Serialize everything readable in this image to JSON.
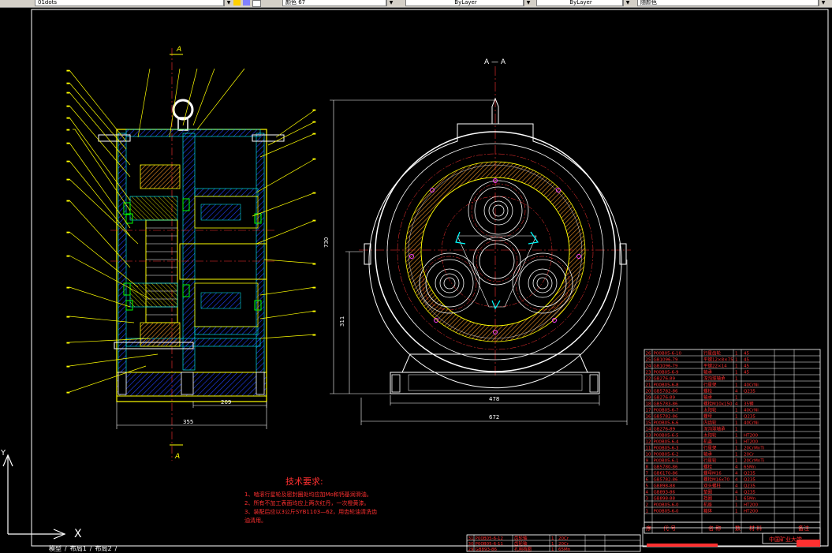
{
  "toolbar": {
    "layer_field": "01dots",
    "color_field": "颜色 67",
    "linetype_field": "ByLayer",
    "lineweight_field": "ByLayer",
    "plotstyle_field": "随颜色"
  },
  "drawing": {
    "section_mark": "A",
    "view_title": "A — A",
    "dims": {
      "width_left": "355",
      "width_inner": "209",
      "height_total": "730",
      "height_center": "311",
      "width_base": "478",
      "width_total": "672"
    },
    "tech_req": {
      "title": "技术要求:",
      "lines": [
        "1、啮滚行星轮及密封圈处均应加Mo和钙基润滑油。",
        "2、所有不加工表面均应上两次红丹，一次橙黄漆。",
        "3、装配后应以3公斤SYB1103—62，用齿轮油清洗齿",
        "   油清用。"
      ]
    },
    "bom": {
      "rows": [
        [
          "P00B05-6-10",
          "行星齿轮",
          "1",
          "45"
        ],
        [
          "GB1096-79",
          "平键12×8×75",
          "1",
          "45"
        ],
        [
          "GB1096-79",
          "平键22×14",
          "1",
          "45"
        ],
        [
          "P00B05-6-9",
          "轴承",
          "1",
          "45"
        ],
        [
          "GB276-89",
          "深沟球轴承",
          "1",
          ""
        ],
        [
          "P00B05-6-8",
          "行星架",
          "1",
          "40CrNi"
        ],
        [
          "GB5782-86",
          "螺栓",
          "4",
          "Q235"
        ],
        [
          "GB276-89",
          "轴承",
          "1",
          ""
        ],
        [
          "GB5783-86",
          "螺栓M10x150",
          "4",
          "35钢"
        ],
        [
          "P00B05-6-7",
          "太阳轮",
          "1",
          "40CrNi"
        ],
        [
          "GB5782-86",
          "螺母",
          "1",
          "Q235"
        ],
        [
          "P00B05-6-6",
          "内齿轮",
          "1",
          "40CrNi"
        ],
        [
          "GB276-89",
          "深沟球轴承",
          "1",
          ""
        ],
        [
          "P00B05-6-5",
          "太阳轮",
          "1",
          "HT200"
        ],
        [
          "P00B05-6-4",
          "机盖",
          "1",
          "HT200"
        ],
        [
          "P00B05-6-3",
          "行星架",
          "1",
          "20CrMnTi"
        ],
        [
          "P00B05-6-2",
          "轴承",
          "1",
          "20Cr"
        ],
        [
          "P00B05-6-1",
          "行星轮",
          "1",
          "20CrMnTi"
        ],
        [
          "GB5780-86",
          "螺栓",
          "4",
          "65Mn"
        ],
        [
          "GB6170-86",
          "螺母M16",
          "4",
          "Q235"
        ],
        [
          "GB5782-86",
          "螺栓M16x70",
          "4",
          "Q235"
        ],
        [
          "GB898-88",
          "双头螺柱",
          "4",
          "Q235"
        ],
        [
          "GB893-86",
          "垫圈",
          "4",
          "Q235"
        ],
        [
          "GB898-88",
          "挡圈",
          "1",
          "65Mn"
        ],
        [
          "P00B05-6-0",
          "机座",
          "1",
          "HT200"
        ],
        [
          "P00B05-6-0",
          "箱体",
          "1",
          "HT200"
        ]
      ],
      "header": {
        "seq": "序",
        "code": "代  号",
        "name": "名  称",
        "qty": "数",
        "mat": "材  料",
        "note": "备注"
      },
      "school": "中国矿业大学"
    },
    "bom2": {
      "rows": [
        [
          "P00B05-6-12",
          "齿轮轴",
          "1",
          "20Cr"
        ],
        [
          "P00B05-6-11",
          "齿轮轴",
          "1",
          "20Cr"
        ],
        [
          "GB893-86",
          "孔用挡圈",
          "1",
          "65Mn"
        ]
      ]
    },
    "ucs": {
      "x": "X",
      "y": "Y"
    }
  },
  "tabs": {
    "model": "模型",
    "layout1": "布局1",
    "layout2": "布局2"
  },
  "colors": {
    "background": "#000000",
    "frame": "#ffffff",
    "outline": "#ffff00",
    "centerline": "#ff3333",
    "hatch": "#0000ff",
    "detail": "#00ffff",
    "text_red": "#ff3030",
    "table": "#ffffff"
  }
}
